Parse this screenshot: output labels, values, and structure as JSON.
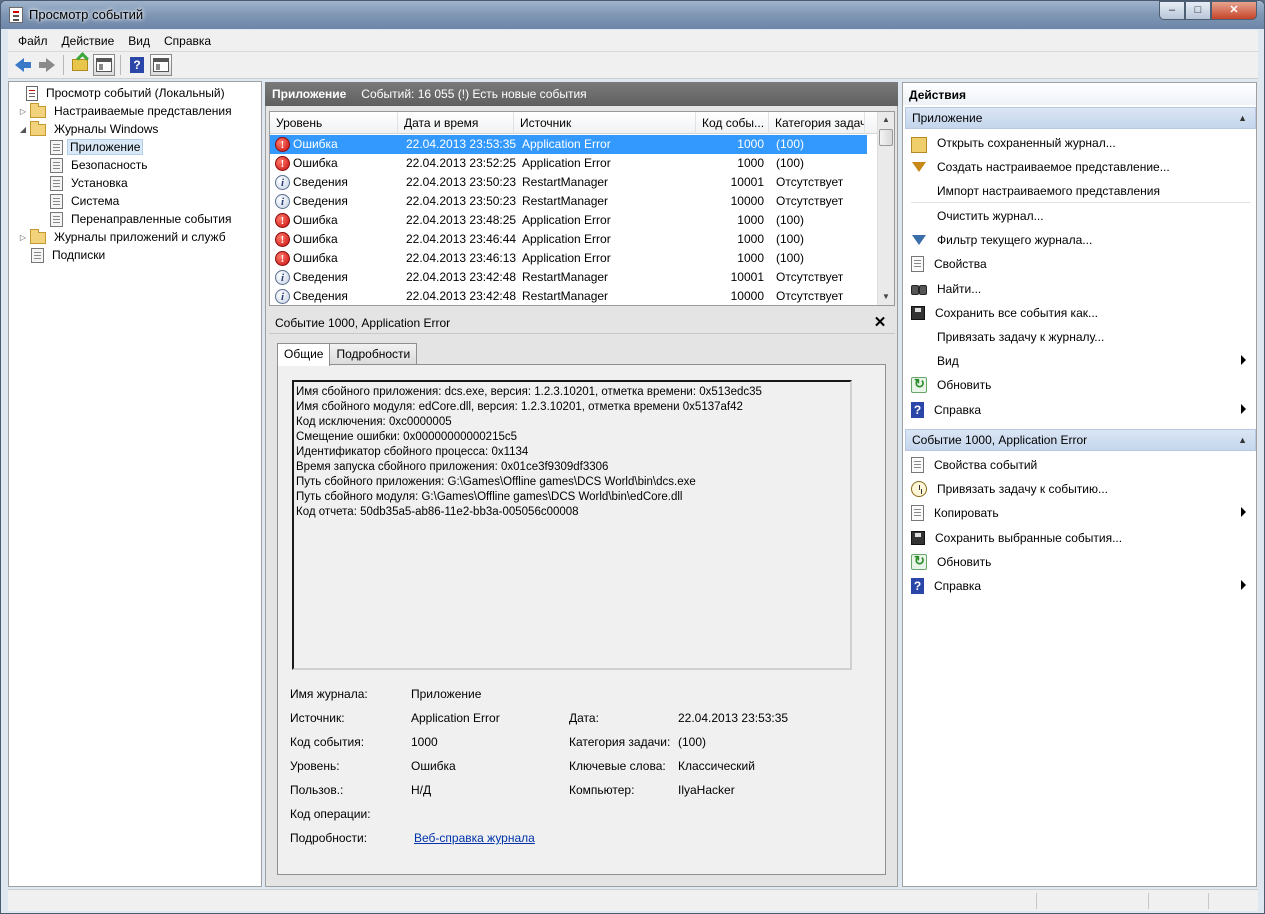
{
  "window": {
    "title": "Просмотр событий",
    "controls": [
      "–",
      "□",
      "✕"
    ]
  },
  "menu": [
    "Файл",
    "Действие",
    "Вид",
    "Справка"
  ],
  "toolbar": {
    "buttons": [
      "back-icon",
      "forward-icon",
      "up-folder-icon",
      "show-hide-tree-icon",
      "help-icon",
      "show-hide-actions-icon"
    ]
  },
  "tree": {
    "items": [
      {
        "label": "Просмотр событий (Локальный)",
        "icon": "event-viewer-icon",
        "expander": ""
      },
      {
        "label": "Настраиваемые представления",
        "icon": "folder-icon",
        "expander": "▷"
      },
      {
        "label": "Журналы Windows",
        "icon": "folder-icon",
        "expander": "◢"
      },
      {
        "label": "Приложение",
        "icon": "log-icon",
        "expander": ""
      },
      {
        "label": "Безопасность",
        "icon": "log-icon",
        "expander": ""
      },
      {
        "label": "Установка",
        "icon": "log-icon",
        "expander": ""
      },
      {
        "label": "Система",
        "icon": "log-icon",
        "expander": ""
      },
      {
        "label": "Перенаправленные события",
        "icon": "log-icon",
        "expander": ""
      },
      {
        "label": "Журналы приложений и служб",
        "icon": "folder-icon",
        "expander": "▷"
      },
      {
        "label": "Подписки",
        "icon": "subscriptions-icon",
        "expander": ""
      }
    ]
  },
  "center": {
    "title": "Приложение",
    "subtitle": "Событий: 16 055 (!) Есть новые события",
    "columns": [
      "Уровень",
      "Дата и время",
      "Источник",
      "Код собы...",
      "Категория задачи"
    ],
    "rows": [
      {
        "level": "Ошибка",
        "type": "error",
        "date": "22.04.2013 23:53:35",
        "source": "Application Error",
        "code": "1000",
        "category": "(100)"
      },
      {
        "level": "Ошибка",
        "type": "error",
        "date": "22.04.2013 23:52:25",
        "source": "Application Error",
        "code": "1000",
        "category": "(100)"
      },
      {
        "level": "Сведения",
        "type": "info",
        "date": "22.04.2013 23:50:23",
        "source": "RestartManager",
        "code": "10001",
        "category": "Отсутствует"
      },
      {
        "level": "Сведения",
        "type": "info",
        "date": "22.04.2013 23:50:23",
        "source": "RestartManager",
        "code": "10000",
        "category": "Отсутствует"
      },
      {
        "level": "Ошибка",
        "type": "error",
        "date": "22.04.2013 23:48:25",
        "source": "Application Error",
        "code": "1000",
        "category": "(100)"
      },
      {
        "level": "Ошибка",
        "type": "error",
        "date": "22.04.2013 23:46:44",
        "source": "Application Error",
        "code": "1000",
        "category": "(100)"
      },
      {
        "level": "Ошибка",
        "type": "error",
        "date": "22.04.2013 23:46:13",
        "source": "Application Error",
        "code": "1000",
        "category": "(100)"
      },
      {
        "level": "Сведения",
        "type": "info",
        "date": "22.04.2013 23:42:48",
        "source": "RestartManager",
        "code": "10001",
        "category": "Отсутствует"
      },
      {
        "level": "Сведения",
        "type": "info",
        "date": "22.04.2013 23:42:48",
        "source": "RestartManager",
        "code": "10000",
        "category": "Отсутствует"
      }
    ]
  },
  "detail": {
    "title": "Событие 1000, Application Error",
    "close": "✕",
    "tabs": [
      "Общие",
      "Подробности"
    ],
    "description": [
      "Имя сбойного приложения: dcs.exe, версия: 1.2.3.10201, отметка времени: 0x513edc35",
      "Имя сбойного модуля: edCore.dll, версия: 1.2.3.10201, отметка времени 0x5137af42",
      "Код исключения: 0xc0000005",
      "Смещение ошибки: 0x00000000000215c5",
      "Идентификатор сбойного процесса: 0x1134",
      "Время запуска сбойного приложения: 0x01ce3f9309df3306",
      "Путь сбойного приложения: G:\\Games\\Offline games\\DCS World\\bin\\dcs.exe",
      "Путь сбойного модуля: G:\\Games\\Offline games\\DCS World\\bin\\edCore.dll",
      "Код отчета: 50db35a5-ab86-11e2-bb3a-005056c00008"
    ],
    "props": {
      "log_name_label": "Имя журнала:",
      "log_name": "Приложение",
      "source_label": "Источник:",
      "source": "Application Error",
      "date_label": "Дата:",
      "date": "22.04.2013 23:53:35",
      "event_id_label": "Код события:",
      "event_id": "1000",
      "task_cat_label": "Категория задачи:",
      "task_cat": "(100)",
      "level_label": "Уровень:",
      "level": "Ошибка",
      "keywords_label": "Ключевые слова:",
      "keywords": "Классический",
      "user_label": "Пользов.:",
      "user": "Н/Д",
      "computer_label": "Компьютер:",
      "computer": "IlyaHacker",
      "opcode_label": "Код операции:",
      "more_label": "Подробности:",
      "more_link": "Веб-справка журнала "
    }
  },
  "actions": {
    "title": "Действия",
    "section1": "Приложение",
    "items1": [
      {
        "label": "Открыть сохраненный журнал...",
        "icon": "open-log-icon"
      },
      {
        "label": "Создать настраиваемое представление...",
        "icon": "create-view-icon"
      },
      {
        "label": "Импорт настраиваемого представления",
        "icon": ""
      },
      {
        "label": "Очистить журнал...",
        "icon": ""
      },
      {
        "label": "Фильтр текущего журнала...",
        "icon": "filter-icon"
      },
      {
        "label": "Свойства",
        "icon": "properties-icon"
      },
      {
        "label": "Найти...",
        "icon": "find-icon"
      },
      {
        "label": "Сохранить все события как...",
        "icon": "save-icon"
      },
      {
        "label": "Привязать задачу к журналу...",
        "icon": ""
      },
      {
        "label": "Вид",
        "icon": "",
        "submenu": true
      },
      {
        "label": "Обновить",
        "icon": "refresh-icon"
      },
      {
        "label": "Справка",
        "icon": "help-icon",
        "submenu": true
      }
    ],
    "section2": "Событие 1000, Application Error",
    "items2": [
      {
        "label": "Свойства событий",
        "icon": "event-properties-icon"
      },
      {
        "label": "Привязать задачу к событию...",
        "icon": "attach-task-icon"
      },
      {
        "label": "Копировать",
        "icon": "copy-icon",
        "submenu": true
      },
      {
        "label": "Сохранить выбранные события...",
        "icon": "save-icon"
      },
      {
        "label": "Обновить",
        "icon": "refresh-icon"
      },
      {
        "label": "Справка",
        "icon": "help-icon",
        "submenu": true
      }
    ]
  },
  "colors": {
    "selection": "#3399ff",
    "error": "#c80f0f",
    "section_header": "#c4d5ec",
    "link": "#0033aa"
  }
}
